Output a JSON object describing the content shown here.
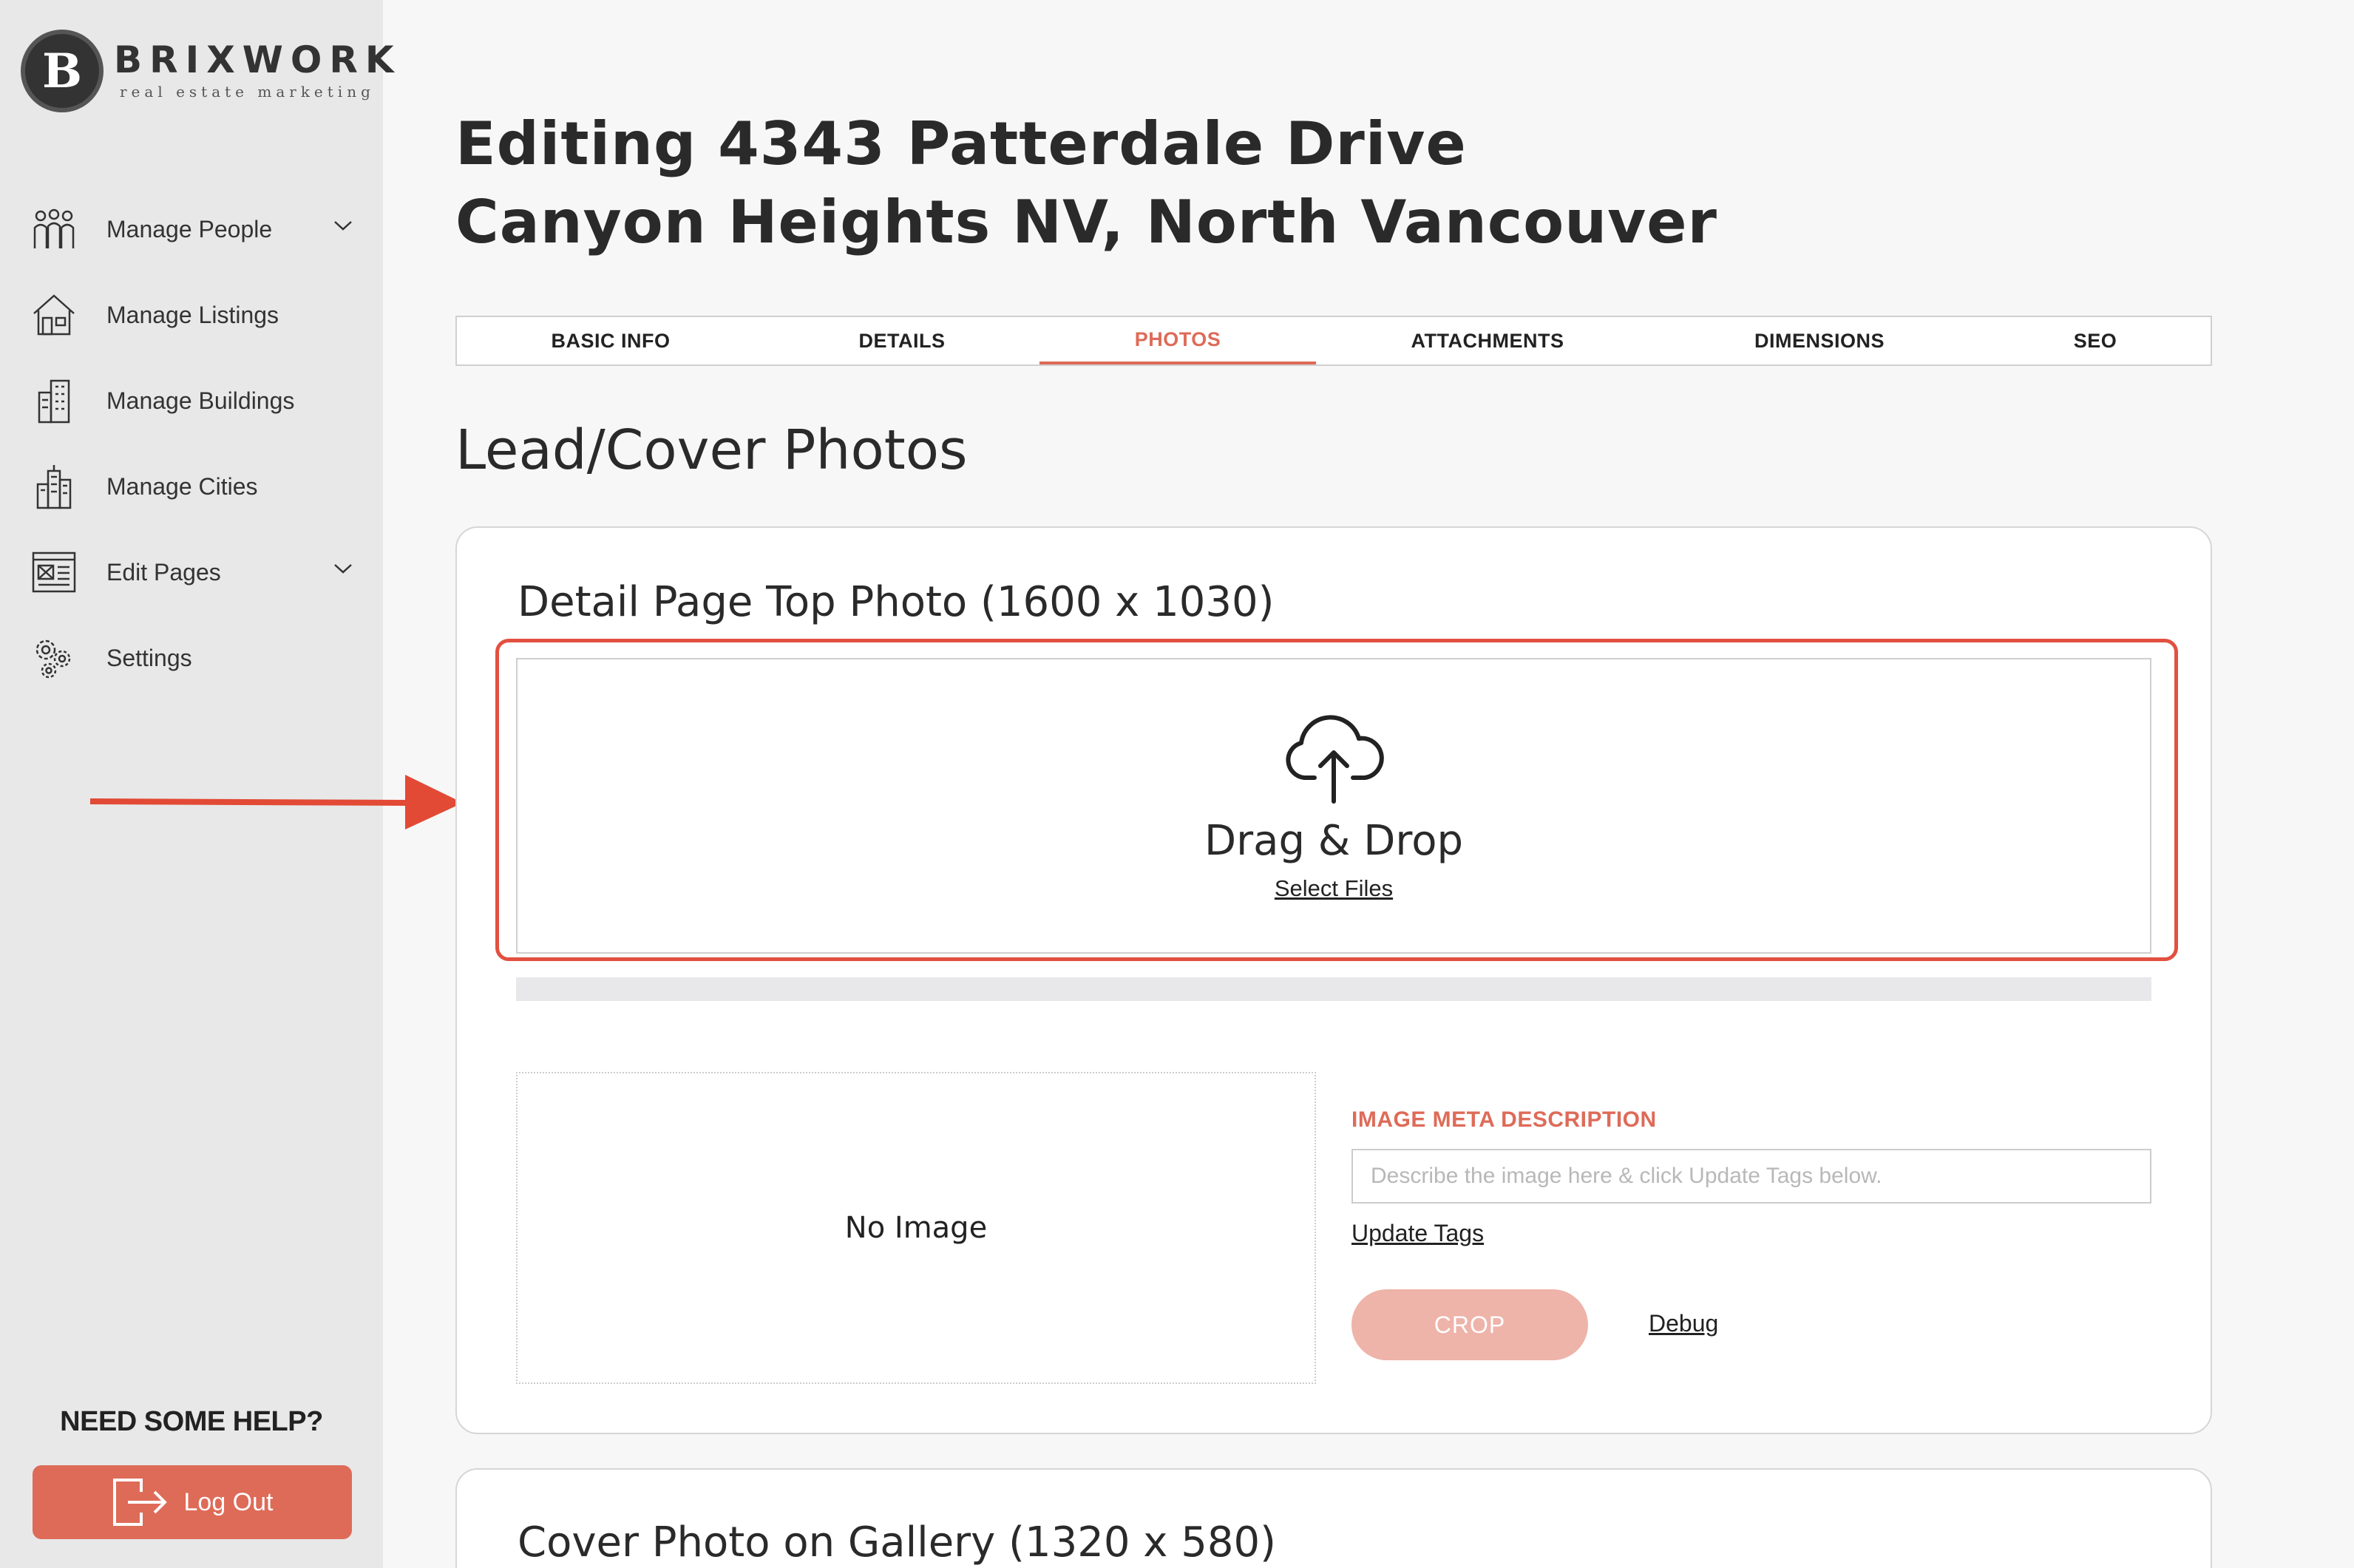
{
  "brand": {
    "name": "BRIXWORK",
    "tagline": "real estate marketing",
    "initial": "B"
  },
  "sidebar": {
    "items": [
      {
        "label": "Manage People",
        "icon": "people-icon",
        "has_submenu": true
      },
      {
        "label": "Manage Listings",
        "icon": "house-icon",
        "has_submenu": false
      },
      {
        "label": "Manage Buildings",
        "icon": "building-icon",
        "has_submenu": false
      },
      {
        "label": "Manage Cities",
        "icon": "city-icon",
        "has_submenu": false
      },
      {
        "label": "Edit Pages",
        "icon": "page-icon",
        "has_submenu": true
      },
      {
        "label": "Settings",
        "icon": "gear-icon",
        "has_submenu": false
      }
    ],
    "help_text": "NEED SOME HELP?",
    "logout_label": "Log Out"
  },
  "page": {
    "title_line1": "Editing 4343 Patterdale Drive",
    "title_line2": "Canyon Heights NV, North Vancouver"
  },
  "tabs": [
    {
      "label": "BASIC INFO",
      "active": false
    },
    {
      "label": "DETAILS",
      "active": false
    },
    {
      "label": "PHOTOS",
      "active": true
    },
    {
      "label": "ATTACHMENTS",
      "active": false
    },
    {
      "label": "DIMENSIONS",
      "active": false
    },
    {
      "label": "SEO",
      "active": false
    }
  ],
  "section": {
    "title": "Lead/Cover Photos"
  },
  "detail_photo": {
    "title": "Detail Page Top Photo (1600 x 1030)",
    "dropzone_title": "Drag & Drop",
    "dropzone_link": "Select Files",
    "no_image": "No Image",
    "meta_label": "IMAGE META DESCRIPTION",
    "meta_placeholder": "Describe the image here & click Update Tags below.",
    "meta_value": "",
    "update_tags": "Update Tags",
    "crop_label": "CROP",
    "debug_label": "Debug"
  },
  "gallery_photo": {
    "title": "Cover Photo on Gallery (1320 x 580)"
  },
  "colors": {
    "accent": "#de6b58",
    "highlight": "#e25040",
    "sidebar_bg": "#e8e8e8"
  }
}
